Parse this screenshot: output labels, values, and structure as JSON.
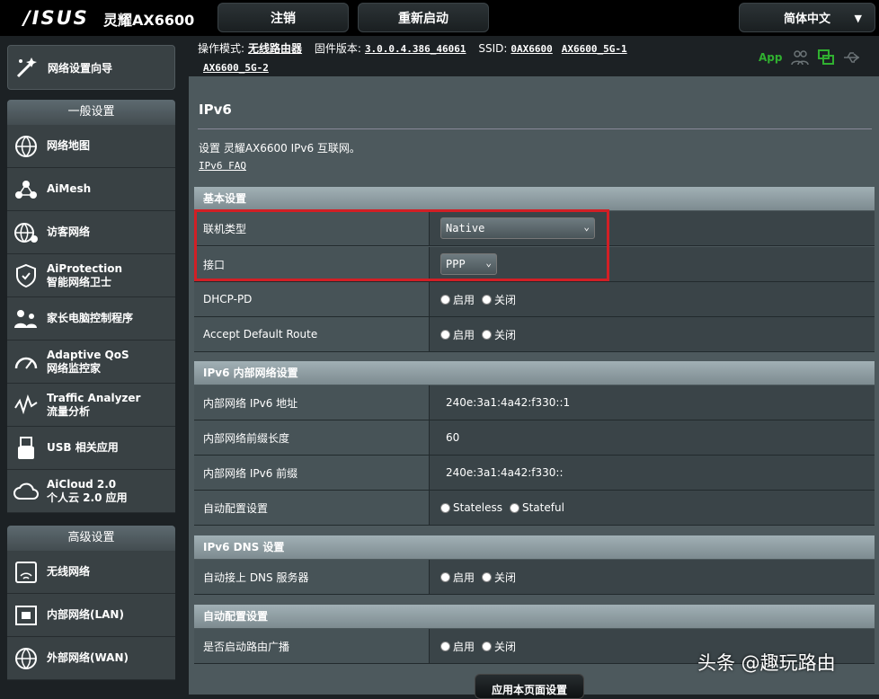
{
  "header": {
    "brand": "/ISUS",
    "model": "灵耀AX6600",
    "logout_label": "注销",
    "reboot_label": "重新启动",
    "language": "简体中文"
  },
  "status": {
    "mode_label": "操作模式:",
    "mode_value": "无线路由器",
    "firmware_label": "固件版本:",
    "firmware_value": "3.0.0.4.386_46061",
    "ssid_label": "SSID:",
    "ssid_values": [
      "0AX6600",
      "AX6600_5G-1",
      "AX6600_5G-2"
    ],
    "app_label": "App"
  },
  "sidebar": {
    "wizard_label": "网络设置向导",
    "general_header": "一般设置",
    "general_items": [
      {
        "label": "网络地图",
        "icon": "globe-map-icon"
      },
      {
        "label": "AiMesh",
        "icon": "aimesh-icon"
      },
      {
        "label": "访客网络",
        "icon": "guest-network-icon"
      },
      {
        "label": "AiProtection",
        "sub": "智能网络卫士",
        "icon": "shield-icon"
      },
      {
        "label": "家长电脑控制程序",
        "icon": "parental-control-icon"
      },
      {
        "label": "Adaptive QoS",
        "sub": "网络监控家",
        "icon": "gauge-icon"
      },
      {
        "label": "Traffic Analyzer",
        "sub": "流量分析",
        "icon": "traffic-icon"
      },
      {
        "label": "USB 相关应用",
        "icon": "usb-icon"
      },
      {
        "label": "AiCloud 2.0",
        "sub": "个人云 2.0 应用",
        "icon": "cloud-icon"
      }
    ],
    "advanced_header": "高级设置",
    "advanced_items": [
      {
        "label": "无线网络",
        "icon": "wireless-icon"
      },
      {
        "label": "内部网络(LAN)",
        "icon": "lan-icon"
      },
      {
        "label": "外部网络(WAN)",
        "icon": "wan-globe-icon"
      }
    ]
  },
  "main": {
    "title": "IPv6",
    "description": "设置 灵耀AX6600 IPv6 互联网。",
    "faq_link": "IPv6 FAQ",
    "basic": {
      "header": "基本设置",
      "connection_type_label": "联机类型",
      "connection_type_value": "Native",
      "interface_label": "接口",
      "interface_value": "PPP",
      "dhcp_pd_label": "DHCP-PD",
      "accept_route_label": "Accept Default Route",
      "enable": "启用",
      "disable": "关闭"
    },
    "lan": {
      "header": "IPv6 内部网络设置",
      "ipv6_addr_label": "内部网络 IPv6 地址",
      "ipv6_addr_value": "240e:3a1:4a42:f330::1",
      "prefix_len_label": "内部网络前缀长度",
      "prefix_len_value": "60",
      "prefix_label": "内部网络 IPv6 前缀",
      "prefix_value": "240e:3a1:4a42:f330::",
      "autoconf_label": "自动配置设置",
      "stateless": "Stateless",
      "stateful": "Stateful"
    },
    "dns": {
      "header": "IPv6 DNS 设置",
      "auto_dns_label": "自动接上 DNS 服务器"
    },
    "autoconfig": {
      "header": "自动配置设置",
      "router_adv_label": "是否启动路由广播"
    },
    "apply_label": "应用本页面设置"
  },
  "watermark": "头条 @趣玩路由",
  "colors": {
    "highlight": "#d21f25",
    "app_green": "#30b030",
    "panel": "#4d595d"
  }
}
